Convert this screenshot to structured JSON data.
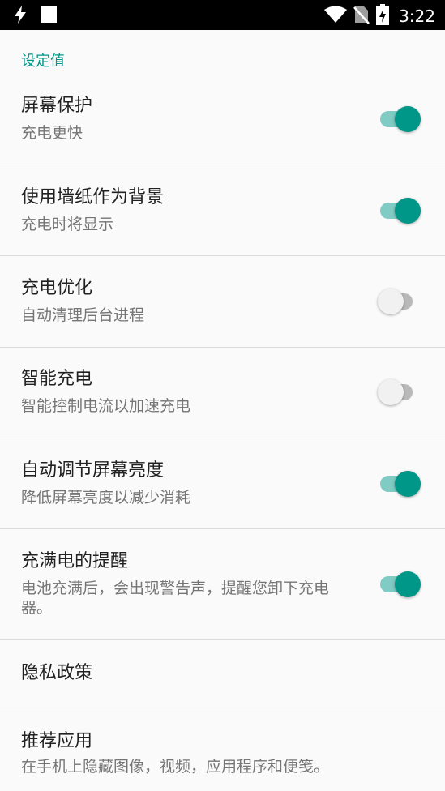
{
  "status_bar": {
    "time": "3:22",
    "icons": [
      "charging-bolt-icon",
      "notification-square-icon",
      "wifi-icon",
      "no-sim-icon",
      "battery-charging-icon"
    ]
  },
  "section_header": "设定值",
  "settings": [
    {
      "title": "屏幕保护",
      "summary": "充电更快",
      "enabled": true
    },
    {
      "title": "使用墙纸作为背景",
      "summary": "充电时将显示",
      "enabled": true
    },
    {
      "title": "充电优化",
      "summary": "自动清理后台进程",
      "enabled": false
    },
    {
      "title": "智能充电",
      "summary": "智能控制电流以加速充电",
      "enabled": false
    },
    {
      "title": "自动调节屏幕亮度",
      "summary": "降低屏幕亮度以减少消耗",
      "enabled": true
    },
    {
      "title": "充满电的提醒",
      "summary": "电池充满后，会出现警告声，提醒您卸下充电器。",
      "enabled": true
    },
    {
      "title": "隐私政策",
      "summary": ""
    },
    {
      "title": "推荐应用",
      "summary": "在手机上隐藏图像，视频，应用程序和便笺。"
    }
  ],
  "colors": {
    "accent": "#009688",
    "accent_track": "#80cbc4",
    "status_bar": "#000000",
    "background": "#fafafa"
  }
}
